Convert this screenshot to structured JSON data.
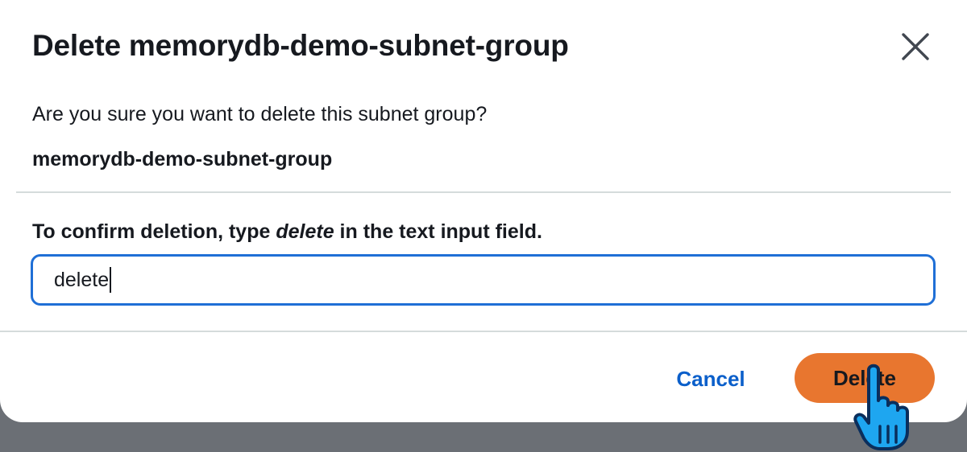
{
  "dialog": {
    "title": "Delete memorydb-demo-subnet-group",
    "close_icon": "close-icon",
    "question": "Are you sure you want to delete this subnet group?",
    "subnet_group_name": "memorydb-demo-subnet-group",
    "confirm_prefix": "To confirm deletion, type ",
    "confirm_keyword": "delete",
    "confirm_suffix": " in the text input field.",
    "input_value": "delete",
    "cancel_label": "Cancel",
    "delete_label": "Delete"
  },
  "colors": {
    "primary_button": "#e8762f",
    "link": "#0b5fca",
    "input_focus_border": "#1f6fd6",
    "overlay": "#6b6f75"
  },
  "pointer": {
    "icon": "hand-pointer-icon"
  }
}
